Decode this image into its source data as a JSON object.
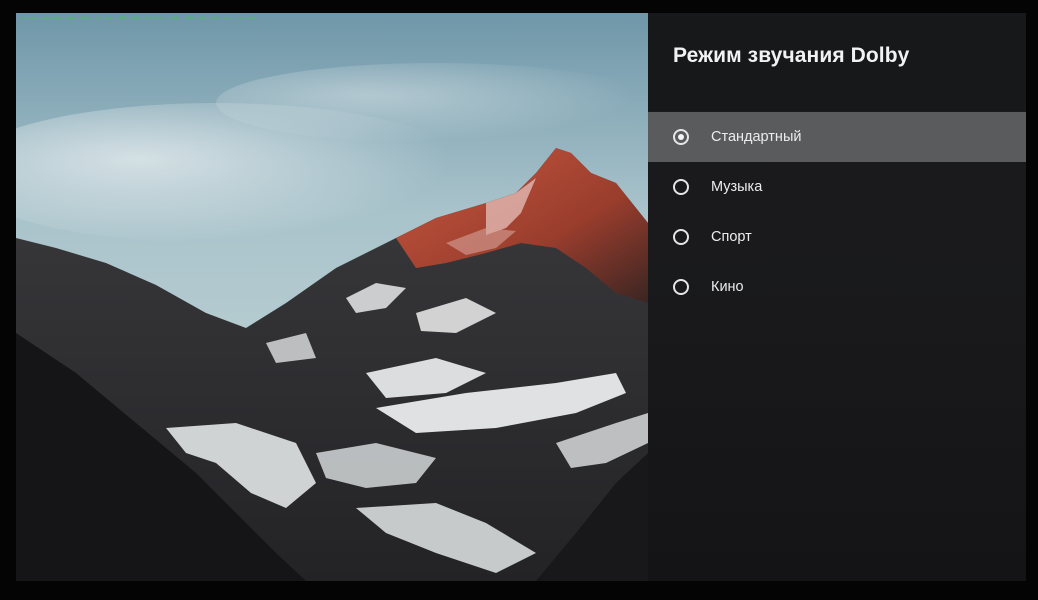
{
  "screen": {
    "osd_overlay_text": "DolbyVision/Dolby Audio Status | Video: 3840x2160p 23.976Hz | Audio: Dolby Digital Plus 5.1 | 48kHz"
  },
  "photo": {
    "description": "mountain-landscape-background"
  },
  "panel": {
    "title": "Режим звучания Dolby",
    "options": [
      {
        "label": "Стандартный",
        "selected": true
      },
      {
        "label": "Музыка",
        "selected": false
      },
      {
        "label": "Спорт",
        "selected": false
      },
      {
        "label": "Кино",
        "selected": false
      }
    ]
  },
  "colors": {
    "panel_bg": "#1b1c1f",
    "selected_row_bg": "#5a5b5c",
    "text": "#ececec",
    "osd_green": "#3cd23c"
  }
}
